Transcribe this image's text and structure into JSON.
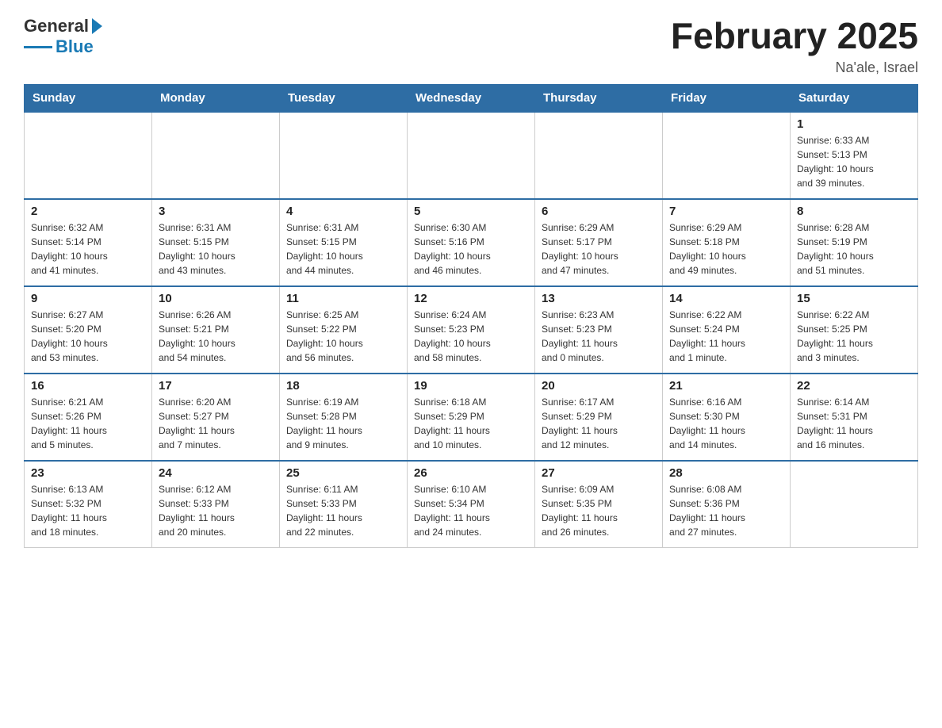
{
  "header": {
    "logo_general": "General",
    "logo_blue": "Blue",
    "title": "February 2025",
    "subtitle": "Na'ale, Israel"
  },
  "days_of_week": [
    "Sunday",
    "Monday",
    "Tuesday",
    "Wednesday",
    "Thursday",
    "Friday",
    "Saturday"
  ],
  "weeks": [
    [
      {
        "day": "",
        "info": ""
      },
      {
        "day": "",
        "info": ""
      },
      {
        "day": "",
        "info": ""
      },
      {
        "day": "",
        "info": ""
      },
      {
        "day": "",
        "info": ""
      },
      {
        "day": "",
        "info": ""
      },
      {
        "day": "1",
        "info": "Sunrise: 6:33 AM\nSunset: 5:13 PM\nDaylight: 10 hours\nand 39 minutes."
      }
    ],
    [
      {
        "day": "2",
        "info": "Sunrise: 6:32 AM\nSunset: 5:14 PM\nDaylight: 10 hours\nand 41 minutes."
      },
      {
        "day": "3",
        "info": "Sunrise: 6:31 AM\nSunset: 5:15 PM\nDaylight: 10 hours\nand 43 minutes."
      },
      {
        "day": "4",
        "info": "Sunrise: 6:31 AM\nSunset: 5:15 PM\nDaylight: 10 hours\nand 44 minutes."
      },
      {
        "day": "5",
        "info": "Sunrise: 6:30 AM\nSunset: 5:16 PM\nDaylight: 10 hours\nand 46 minutes."
      },
      {
        "day": "6",
        "info": "Sunrise: 6:29 AM\nSunset: 5:17 PM\nDaylight: 10 hours\nand 47 minutes."
      },
      {
        "day": "7",
        "info": "Sunrise: 6:29 AM\nSunset: 5:18 PM\nDaylight: 10 hours\nand 49 minutes."
      },
      {
        "day": "8",
        "info": "Sunrise: 6:28 AM\nSunset: 5:19 PM\nDaylight: 10 hours\nand 51 minutes."
      }
    ],
    [
      {
        "day": "9",
        "info": "Sunrise: 6:27 AM\nSunset: 5:20 PM\nDaylight: 10 hours\nand 53 minutes."
      },
      {
        "day": "10",
        "info": "Sunrise: 6:26 AM\nSunset: 5:21 PM\nDaylight: 10 hours\nand 54 minutes."
      },
      {
        "day": "11",
        "info": "Sunrise: 6:25 AM\nSunset: 5:22 PM\nDaylight: 10 hours\nand 56 minutes."
      },
      {
        "day": "12",
        "info": "Sunrise: 6:24 AM\nSunset: 5:23 PM\nDaylight: 10 hours\nand 58 minutes."
      },
      {
        "day": "13",
        "info": "Sunrise: 6:23 AM\nSunset: 5:23 PM\nDaylight: 11 hours\nand 0 minutes."
      },
      {
        "day": "14",
        "info": "Sunrise: 6:22 AM\nSunset: 5:24 PM\nDaylight: 11 hours\nand 1 minute."
      },
      {
        "day": "15",
        "info": "Sunrise: 6:22 AM\nSunset: 5:25 PM\nDaylight: 11 hours\nand 3 minutes."
      }
    ],
    [
      {
        "day": "16",
        "info": "Sunrise: 6:21 AM\nSunset: 5:26 PM\nDaylight: 11 hours\nand 5 minutes."
      },
      {
        "day": "17",
        "info": "Sunrise: 6:20 AM\nSunset: 5:27 PM\nDaylight: 11 hours\nand 7 minutes."
      },
      {
        "day": "18",
        "info": "Sunrise: 6:19 AM\nSunset: 5:28 PM\nDaylight: 11 hours\nand 9 minutes."
      },
      {
        "day": "19",
        "info": "Sunrise: 6:18 AM\nSunset: 5:29 PM\nDaylight: 11 hours\nand 10 minutes."
      },
      {
        "day": "20",
        "info": "Sunrise: 6:17 AM\nSunset: 5:29 PM\nDaylight: 11 hours\nand 12 minutes."
      },
      {
        "day": "21",
        "info": "Sunrise: 6:16 AM\nSunset: 5:30 PM\nDaylight: 11 hours\nand 14 minutes."
      },
      {
        "day": "22",
        "info": "Sunrise: 6:14 AM\nSunset: 5:31 PM\nDaylight: 11 hours\nand 16 minutes."
      }
    ],
    [
      {
        "day": "23",
        "info": "Sunrise: 6:13 AM\nSunset: 5:32 PM\nDaylight: 11 hours\nand 18 minutes."
      },
      {
        "day": "24",
        "info": "Sunrise: 6:12 AM\nSunset: 5:33 PM\nDaylight: 11 hours\nand 20 minutes."
      },
      {
        "day": "25",
        "info": "Sunrise: 6:11 AM\nSunset: 5:33 PM\nDaylight: 11 hours\nand 22 minutes."
      },
      {
        "day": "26",
        "info": "Sunrise: 6:10 AM\nSunset: 5:34 PM\nDaylight: 11 hours\nand 24 minutes."
      },
      {
        "day": "27",
        "info": "Sunrise: 6:09 AM\nSunset: 5:35 PM\nDaylight: 11 hours\nand 26 minutes."
      },
      {
        "day": "28",
        "info": "Sunrise: 6:08 AM\nSunset: 5:36 PM\nDaylight: 11 hours\nand 27 minutes."
      },
      {
        "day": "",
        "info": ""
      }
    ]
  ]
}
